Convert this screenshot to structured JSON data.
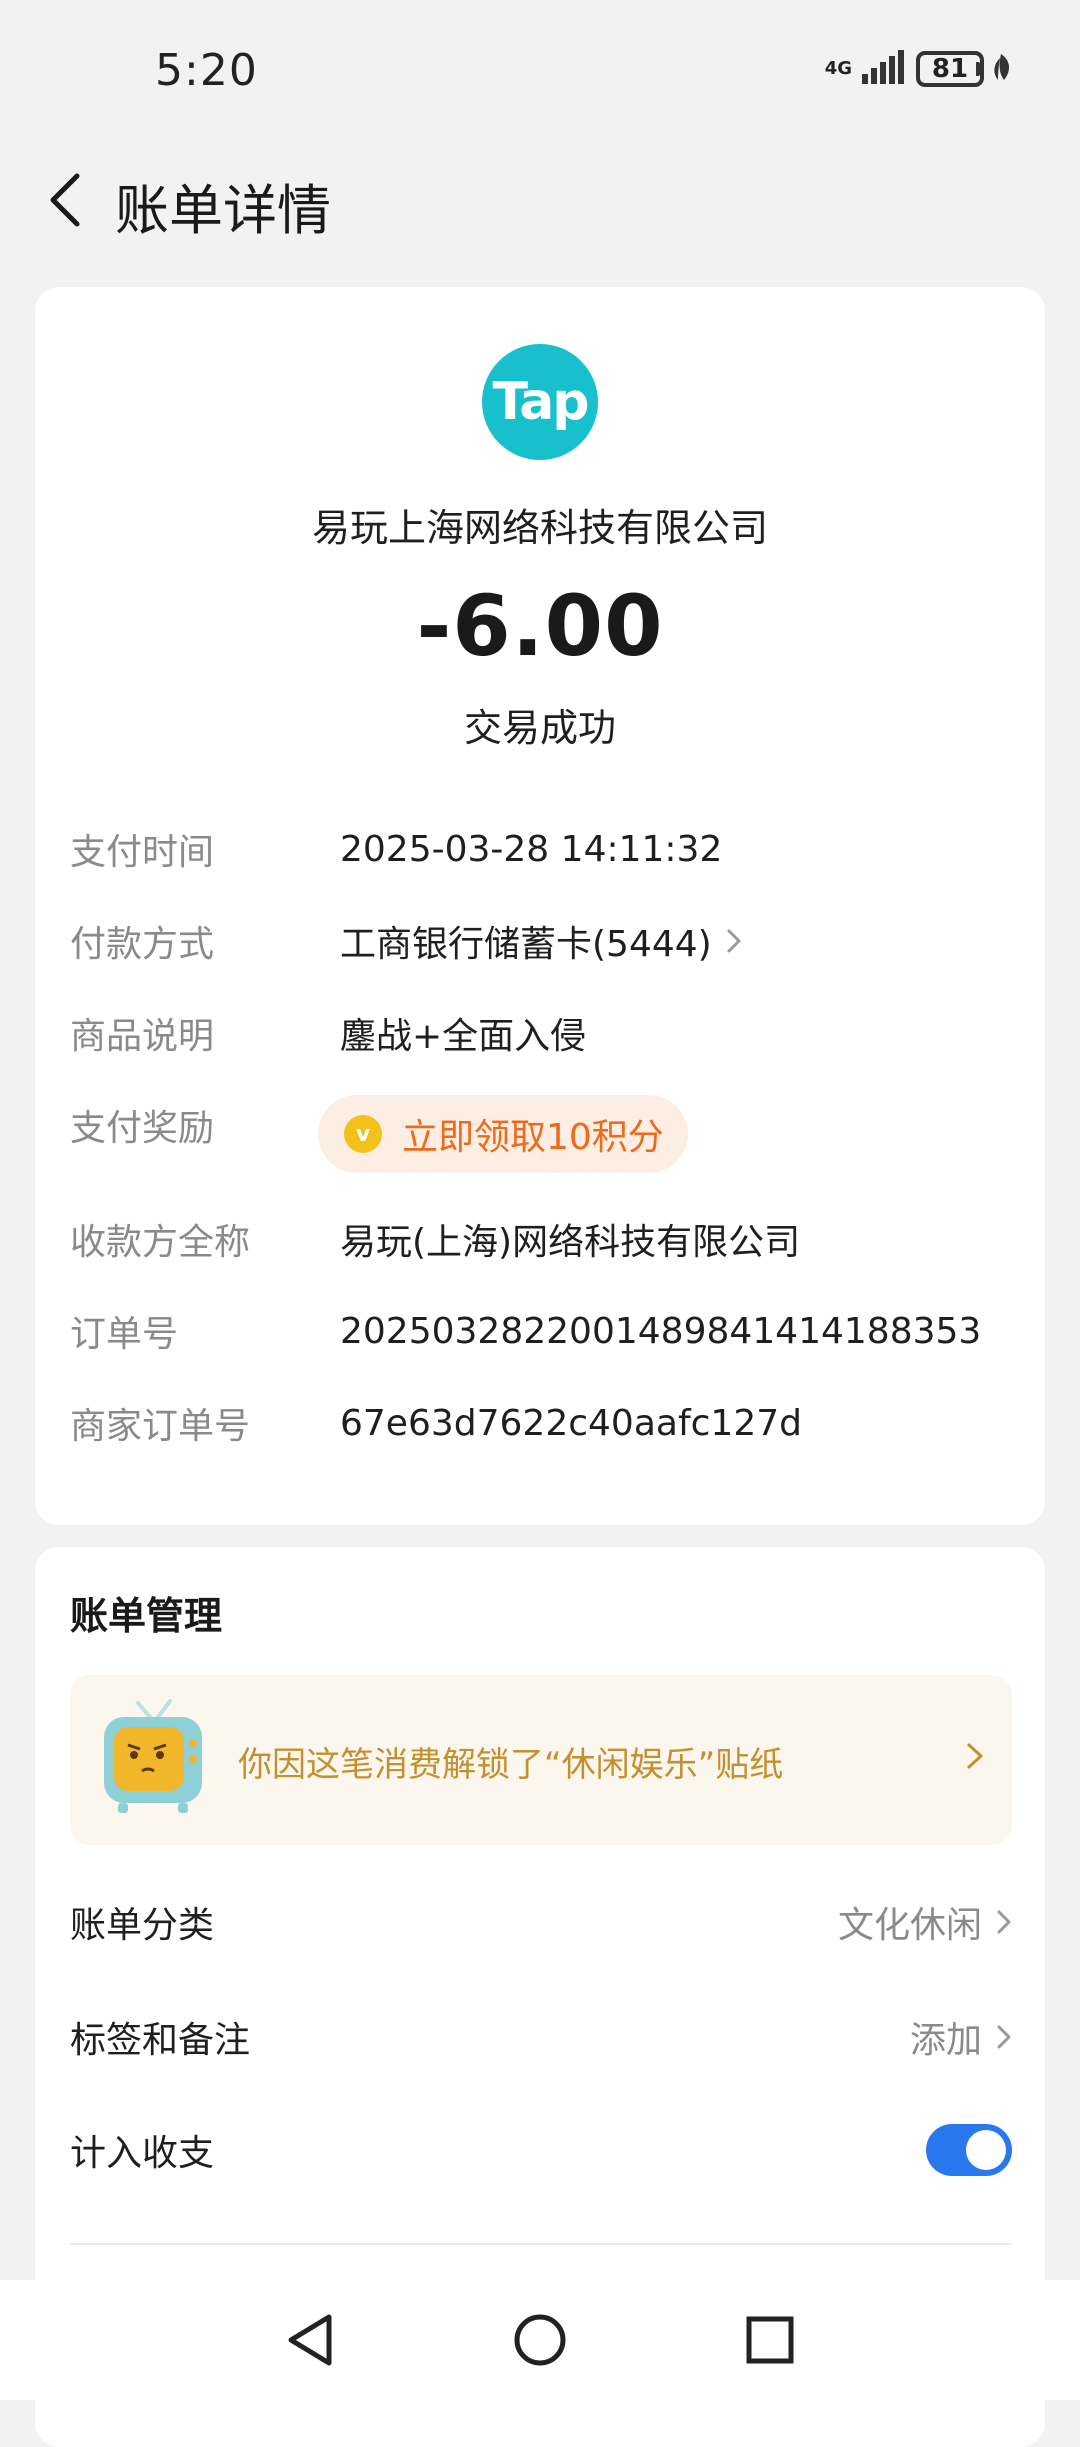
{
  "status_bar": {
    "time": "5:20",
    "network": "4G",
    "battery": "81"
  },
  "header": {
    "title": "账单详情"
  },
  "transaction": {
    "logo_text": "Tap",
    "merchant": "易玩上海网络科技有限公司",
    "amount": "-6.00",
    "status": "交易成功",
    "details": [
      {
        "label": "支付时间",
        "value": "2025-03-28 14:11:32"
      },
      {
        "label": "付款方式",
        "value": "工商银行储蓄卡(5444)"
      },
      {
        "label": "商品说明",
        "value": "鏖战+全面入侵"
      },
      {
        "label": "支付奖励",
        "value": "立即领取10积分"
      },
      {
        "label": "收款方全称",
        "value": "易玩(上海)网络科技有限公司"
      },
      {
        "label": "订单号",
        "value": "2025032822001489841414188353"
      },
      {
        "label": "商家订单号",
        "value": "67e63d7622c40aafc127d"
      }
    ]
  },
  "management": {
    "title": "账单管理",
    "sticker_text": "你因这笔消费解锁了“休闲娱乐”贴纸",
    "rows": [
      {
        "label": "账单分类",
        "value": "文化休闲"
      },
      {
        "label": "标签和备注",
        "value": "添加"
      },
      {
        "label": "计入收支",
        "value": ""
      }
    ],
    "count_toggle_on": true
  },
  "colors": {
    "logo": "#18c0cd",
    "reward": "#f06a1b",
    "sticker_text": "#c4902e",
    "toggle": "#2a78f0"
  }
}
